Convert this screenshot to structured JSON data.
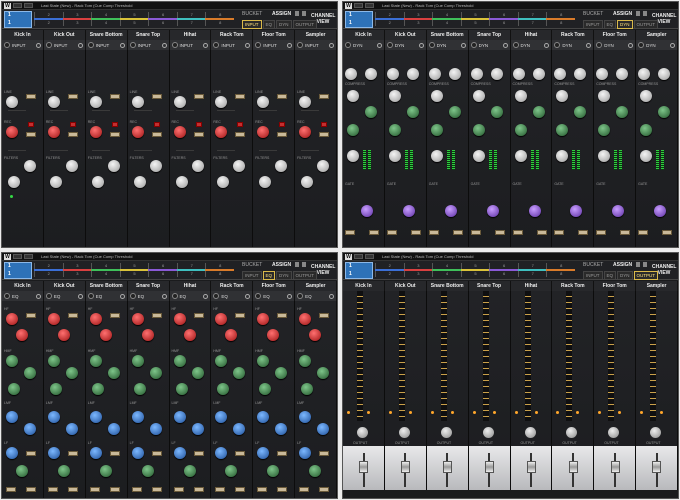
{
  "header": {
    "title": "Last State (New) - Rack Tom (Cue Comp Threshold",
    "bank": {
      "top": "1",
      "bottom": "1"
    },
    "bank_numbers_top": [
      "2",
      "3",
      "4",
      "5",
      "6",
      "7",
      "8"
    ],
    "bank_numbers_bottom": [
      "2",
      "3",
      "4",
      "5",
      "6",
      "7",
      "8"
    ],
    "bank_colors": [
      "#3b6fd6",
      "#d94040",
      "#3fbf5a",
      "#d9c23a",
      "#8a5ad6",
      "#3fbfbf",
      "#d97b2a"
    ],
    "bucket_label": "BUCKET",
    "assign_label": "ASSIGN",
    "modes": [
      "INPUT",
      "EQ",
      "DYN",
      "OUTPUT"
    ],
    "channel_view_label": "CHANNEL VIEW"
  },
  "channels": [
    "Kick In",
    "Kick Out",
    "Snare Bottom",
    "Snare Top",
    "Hihat",
    "Rack Tom",
    "Floor Tom",
    "Sampler"
  ],
  "panels": [
    {
      "id": "input",
      "active_mode": "INPUT",
      "channel_label": "INPUT",
      "section_labels": {
        "line": "LINE",
        "rec": "REC",
        "filters": "FILTERS",
        "analog": "ANALOG"
      },
      "badges": [
        "ST",
        "DUO",
        "MS"
      ]
    },
    {
      "id": "dyn",
      "active_mode": "DYN",
      "channel_label": "DYN",
      "section_labels": {
        "comp": "COMPRESS",
        "gate": "GATE"
      },
      "badges": [
        "ST"
      ]
    },
    {
      "id": "eq",
      "active_mode": "EQ",
      "channel_label": "EQ",
      "section_labels": {
        "hf": "HF",
        "hmf": "HMF",
        "lmf": "LMF",
        "lf": "LF"
      },
      "badges": []
    },
    {
      "id": "output",
      "active_mode": "OUTPUT",
      "channel_label": "",
      "section_labels": {
        "output": "OUTPUT"
      },
      "badges": []
    }
  ]
}
